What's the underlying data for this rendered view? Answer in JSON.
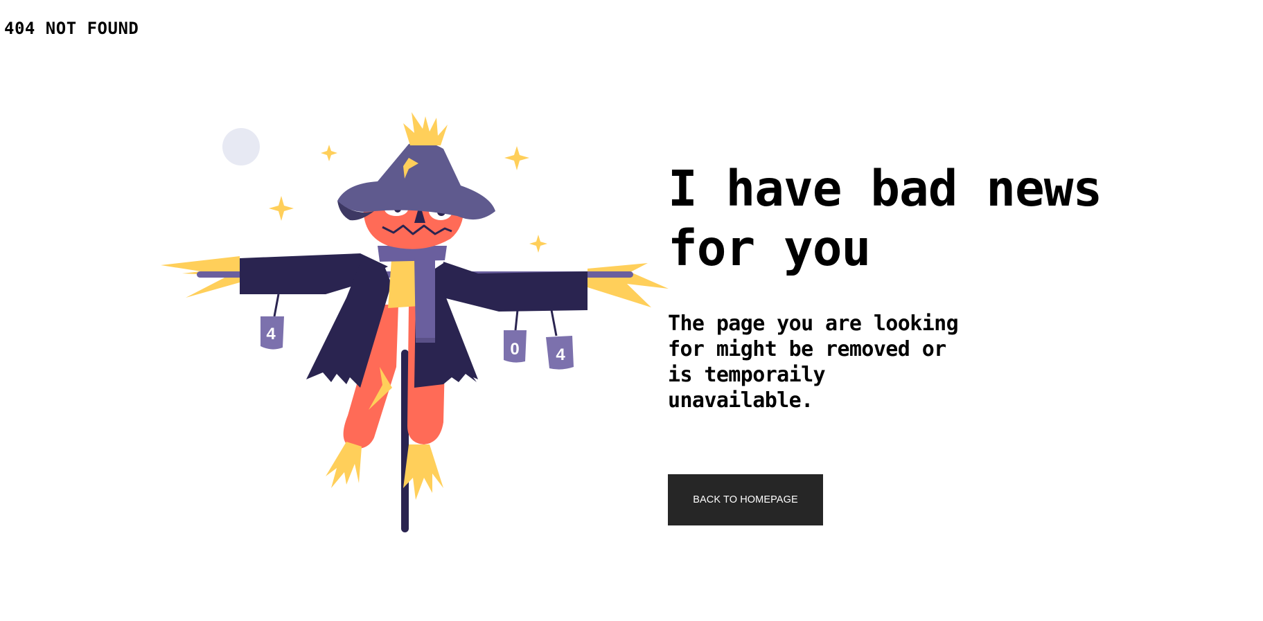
{
  "page": {
    "top_title": "404 NOT FOUND",
    "headline_line1": "I have bad news",
    "headline_line2": "for you",
    "description_line1": "The page you are looking",
    "description_line2": "for might be removed or",
    "description_line3": "is temporaily",
    "description_line4": "unavailable.",
    "back_button_label": "BACK TO HOMEPAGE"
  },
  "illustration": {
    "can_labels": [
      "4",
      "0",
      "4"
    ],
    "colors": {
      "moon": "#e7e9f3",
      "sparkle": "#ffcf5a",
      "straw": "#ffcf5a",
      "hat": "#5f5a8e",
      "hat_dark": "#3d3863",
      "face": "#ff6b57",
      "jacket": "#2a2450",
      "scarf": "#6a5f9e",
      "pants": "#ff6b57",
      "pole": "#2a2450",
      "cans": "#7c71ad",
      "button_bg": "#262626",
      "button_text": "#ffffff"
    }
  }
}
